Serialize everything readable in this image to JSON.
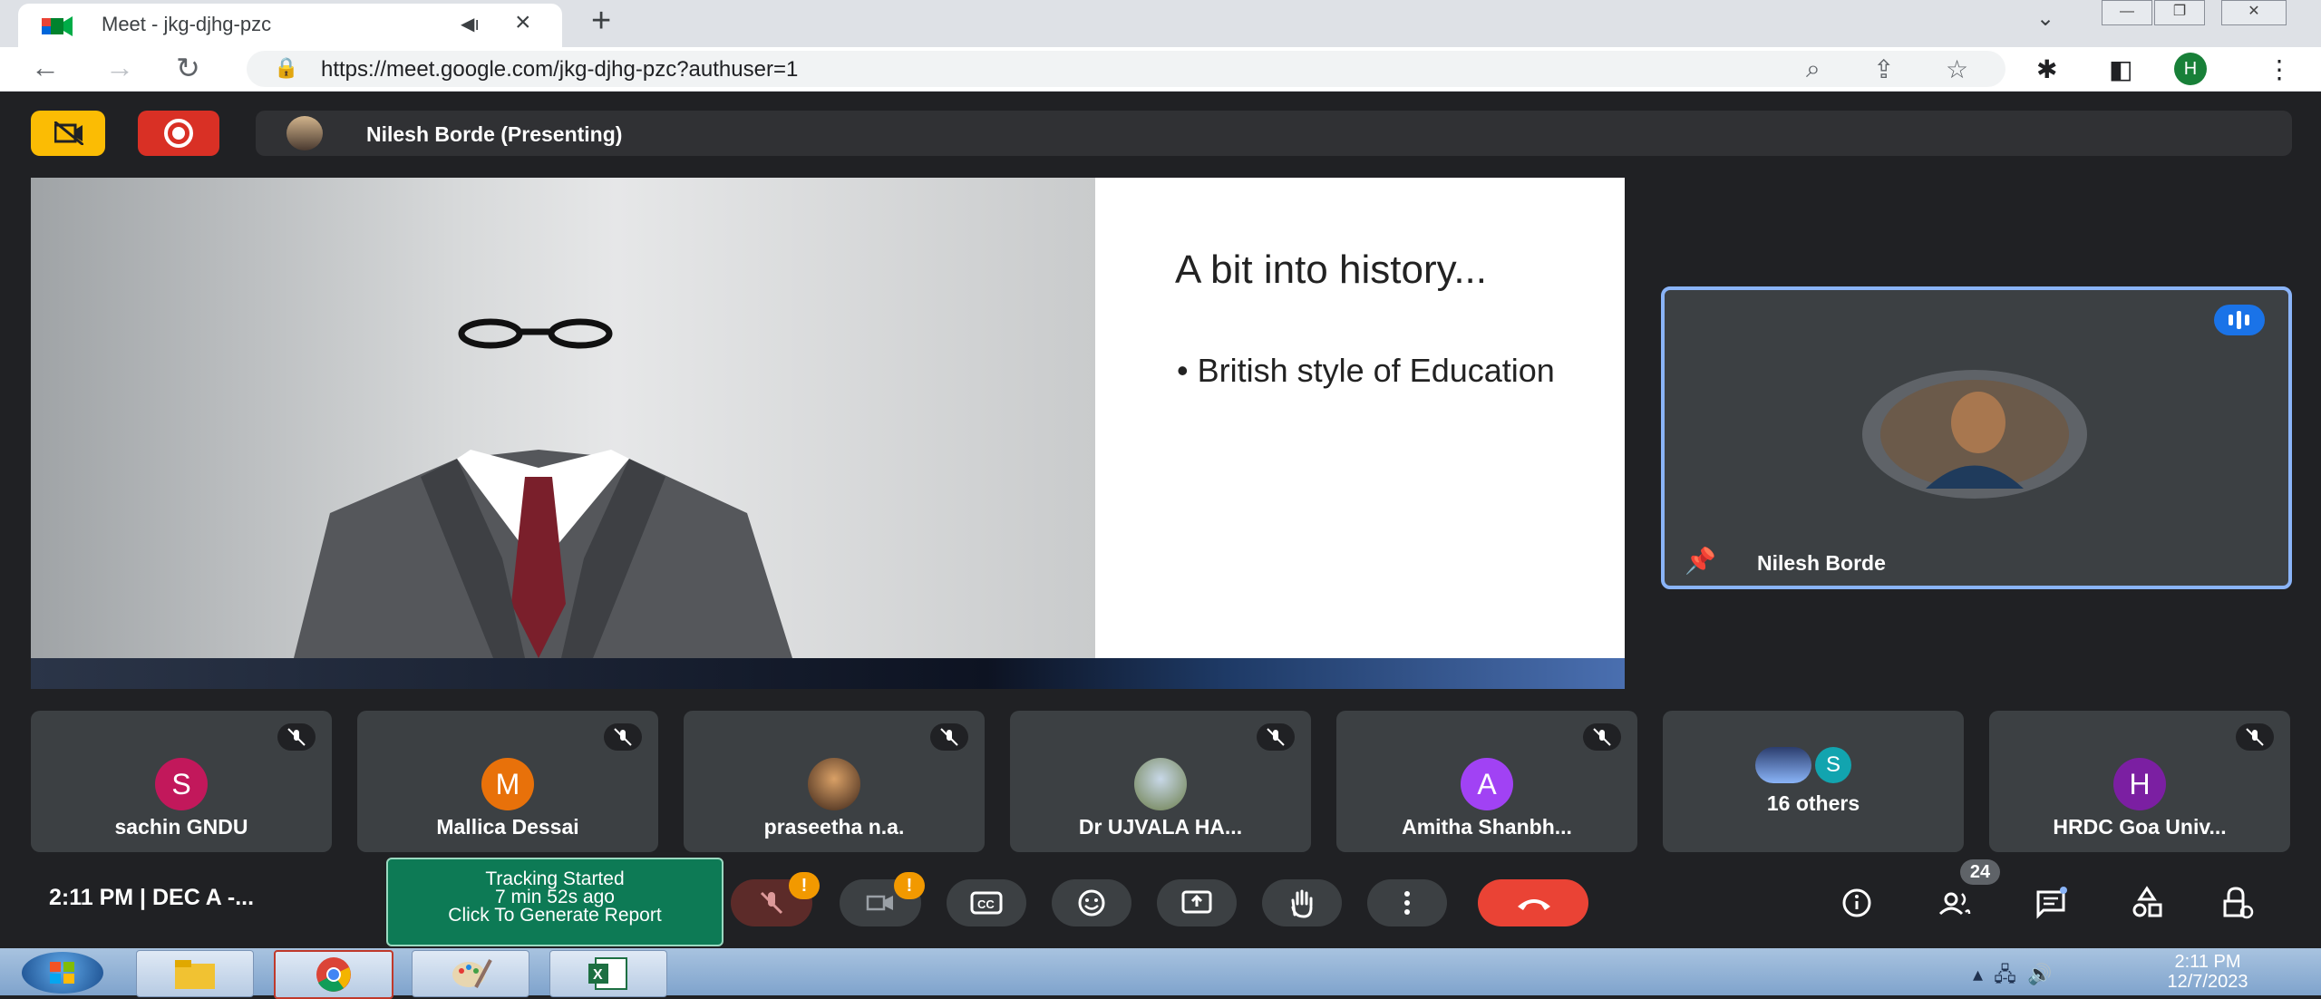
{
  "browser": {
    "tab_title": "Meet - jkg-djhg-pzc",
    "url": "https://meet.google.com/jkg-djhg-pzc?authuser=1",
    "profile_initial": "H"
  },
  "meet": {
    "presenting_label": "Nilesh Borde (Presenting)",
    "slide": {
      "title": "A bit into history...",
      "bullet": "British style of Education"
    },
    "speaker": {
      "name": "Nilesh Borde"
    },
    "participants": [
      {
        "name": "sachin GNDU",
        "initial": "S",
        "color": "#c2185b"
      },
      {
        "name": "Mallica Dessai",
        "initial": "M",
        "color": "#e8710a"
      },
      {
        "name": "praseetha n.a.",
        "initial": "",
        "color": "#6d4c41"
      },
      {
        "name": "Dr UJVALA HA...",
        "initial": "",
        "color": "#8d9a7a"
      },
      {
        "name": "Amitha Shanbh...",
        "initial": "A",
        "color": "#a142f4"
      },
      {
        "name": "16 others",
        "initial": "S",
        "color": "#12a4af"
      },
      {
        "name": "HRDC Goa Univ...",
        "initial": "H",
        "color": "#7b1fa2"
      }
    ],
    "meeting_time": "2:11 PM  |  DEC A -...",
    "tracking": {
      "line1": "Tracking Started",
      "line2": "7 min 52s ago",
      "line3": "Click To Generate Report"
    },
    "mic_badge": "!",
    "cam_badge": "!",
    "people_count": "24"
  },
  "taskbar": {
    "time": "2:11 PM",
    "date": "12/7/2023"
  },
  "colors": {
    "accent": "#1a73e8",
    "hangup": "#ea4335",
    "tracking": "#0d7a55"
  }
}
